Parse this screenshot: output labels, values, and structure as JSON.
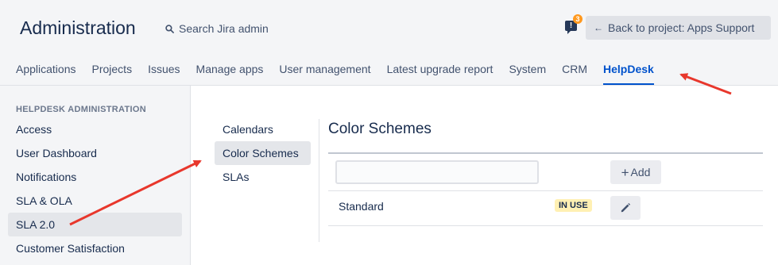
{
  "header": {
    "title": "Administration",
    "search_label": "Search Jira admin",
    "notification_count": "3",
    "back_button_label": "Back to project: Apps Support"
  },
  "nav": {
    "items": [
      {
        "label": "Applications"
      },
      {
        "label": "Projects"
      },
      {
        "label": "Issues"
      },
      {
        "label": "Manage apps"
      },
      {
        "label": "User management"
      },
      {
        "label": "Latest upgrade report"
      },
      {
        "label": "System"
      },
      {
        "label": "CRM"
      },
      {
        "label": "HelpDesk",
        "active": true
      }
    ]
  },
  "sidebar": {
    "heading": "HELPDESK ADMINISTRATION",
    "items": [
      {
        "label": "Access"
      },
      {
        "label": "User Dashboard"
      },
      {
        "label": "Notifications"
      },
      {
        "label": "SLA & OLA"
      },
      {
        "label": "SLA 2.0",
        "selected": true
      },
      {
        "label": "Customer Satisfaction"
      }
    ]
  },
  "subnav": {
    "items": [
      {
        "label": "Calendars"
      },
      {
        "label": "Color Schemes",
        "selected": true
      },
      {
        "label": "SLAs"
      }
    ]
  },
  "content": {
    "title": "Color Schemes",
    "filter_value": "",
    "add_label": "Add",
    "rows": [
      {
        "name": "Standard",
        "badge": "IN USE"
      }
    ]
  },
  "colors": {
    "accent": "#0052cc",
    "annotation_arrow": "#e8372c",
    "badge_bg": "#fff0b3",
    "notification_badge": "#ff991f"
  }
}
